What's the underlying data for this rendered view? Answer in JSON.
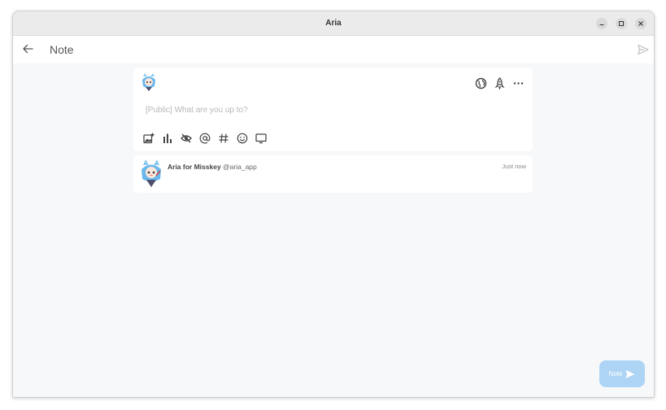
{
  "window": {
    "title": "Aria",
    "controls": [
      "minimize-icon",
      "maximize-icon",
      "close-icon"
    ]
  },
  "appbar": {
    "back_icon": "arrow-left-icon",
    "title": "Note",
    "send_icon": "send-icon"
  },
  "compose": {
    "avatar": "aria-avatar",
    "visibility_icon": "globe-icon",
    "rocket_icon": "rocket-icon",
    "more_icon": "more-horizontal-icon",
    "placeholder": "[Public] What are you up to?",
    "toolbar": [
      "add-image-icon",
      "poll-icon",
      "eye-off-icon",
      "mention-icon",
      "hashtag-icon",
      "emoji-icon",
      "monitor-icon"
    ]
  },
  "preview": {
    "name": "Aria for Misskey",
    "handle": "@aria_app",
    "time": "Just now"
  },
  "fab": {
    "label": "Note"
  },
  "colors": {
    "accent": "#aed4f5",
    "background": "#f7f8fa",
    "titlebar": "#ebebeb"
  }
}
